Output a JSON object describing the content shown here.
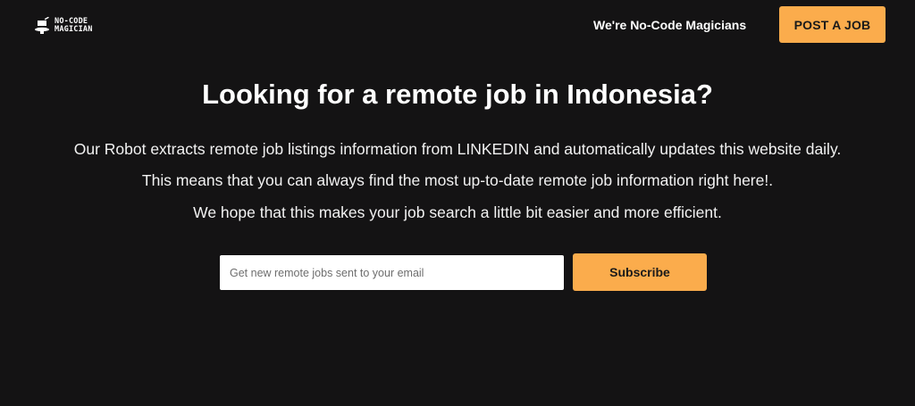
{
  "brand": {
    "logo_icon": "magician-hat-icon",
    "logo_line1": "NO-CODE",
    "logo_line2": "MAGICIAN"
  },
  "nav": {
    "link_label": "We're No-Code Magicians",
    "post_job_label": "POST A JOB"
  },
  "hero": {
    "title": "Looking for a remote job in Indonesia?",
    "line1": "Our Robot extracts remote job listings information from LINKEDIN and automatically updates this website daily.",
    "line2": "This means that you can always find the most up-to-date remote job information right here!.",
    "line3": "We hope that this makes your job search a little bit easier and more efficient."
  },
  "subscribe": {
    "email_value": "",
    "email_placeholder": "Get new remote jobs sent to your email",
    "button_label": "Subscribe"
  },
  "colors": {
    "background": "#141314",
    "accent": "#fbac4c",
    "text": "#ffffff",
    "button_text": "#1a1a1a"
  }
}
